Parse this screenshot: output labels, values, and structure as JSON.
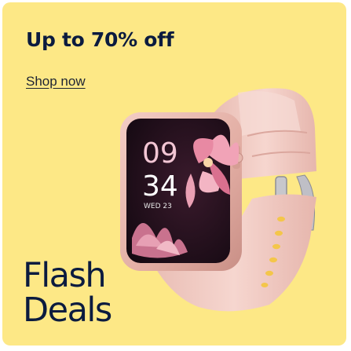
{
  "promo": {
    "headline": "Up to 70% off",
    "link_label": "Shop now",
    "badge_line1": "Flash",
    "badge_line2": "Deals"
  },
  "product": {
    "name": "smartwatch",
    "screen": {
      "hour": "09",
      "minute": "34",
      "date": "WED 23"
    }
  },
  "colors": {
    "background": "#fde886",
    "text": "#0b1b3f",
    "strap": "#f2ccc4",
    "watch_face": "#1a0d18"
  }
}
